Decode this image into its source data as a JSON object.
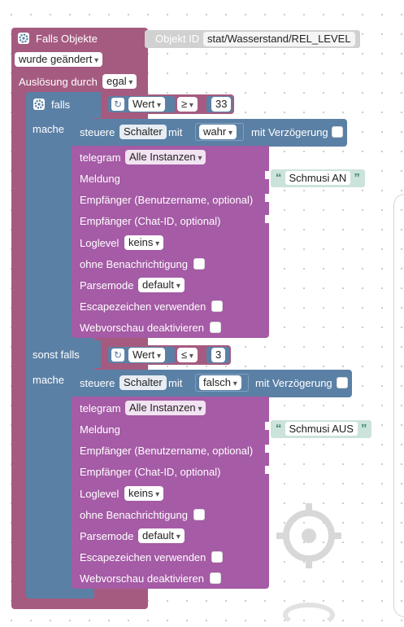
{
  "trigger": {
    "title": "Falls Objekte",
    "object_id_label": "Objekt ID",
    "object_id_value": "stat/Wasserstand/REL_LEVEL",
    "change_mode": "wurde geändert",
    "trigger_by_label": "Auslösung durch",
    "trigger_by_value": "egal"
  },
  "if_block": {
    "if_label": "falls",
    "do_label": "mache",
    "else_if_label": "sonst falls",
    "conditions": [
      {
        "value_label": "Wert",
        "operator": "≥",
        "number": "33"
      },
      {
        "value_label": "Wert",
        "operator": "≤",
        "number": "3"
      }
    ]
  },
  "control_blocks": [
    {
      "label": "steuere",
      "target": "Schalter",
      "with_label": "mit",
      "value": "wahr",
      "delay_label": "mit Verzögerung"
    },
    {
      "label": "steuere",
      "target": "Schalter",
      "with_label": "mit",
      "value": "falsch",
      "delay_label": "mit Verzögerung"
    }
  ],
  "telegram_blocks": [
    {
      "telegram_label": "telegram",
      "instances": "Alle Instanzen",
      "message_label": "Meldung",
      "message_value": "Schmusi AN",
      "recipient_user_label": "Empfänger (Benutzername, optional)",
      "recipient_chat_label": "Empfänger (Chat-ID, optional)",
      "loglevel_label": "Loglevel",
      "loglevel_value": "keins",
      "silent_label": "ohne Benachrichtigung",
      "parsemode_label": "Parsemode",
      "parsemode_value": "default",
      "escape_label": "Escapezeichen verwenden",
      "preview_label": "Webvorschau deaktivieren"
    },
    {
      "telegram_label": "telegram",
      "instances": "Alle Instanzen",
      "message_label": "Meldung",
      "message_value": "Schmusi AUS",
      "recipient_user_label": "Empfänger (Benutzername, optional)",
      "recipient_chat_label": "Empfänger (Chat-ID, optional)",
      "loglevel_label": "Loglevel",
      "loglevel_value": "keins",
      "silent_label": "ohne Benachrichtigung",
      "parsemode_label": "Parsemode",
      "parsemode_value": "default",
      "escape_label": "Escapezeichen verwenden",
      "preview_label": "Webvorschau deaktivieren"
    }
  ],
  "colors": {
    "trigger_block": "#a55b80",
    "logic_block": "#5b80a5",
    "telegram_block": "#a55ba5",
    "compare_block": "#a55b80",
    "string_block": "#cce3db",
    "text_block": "#dddddd"
  }
}
